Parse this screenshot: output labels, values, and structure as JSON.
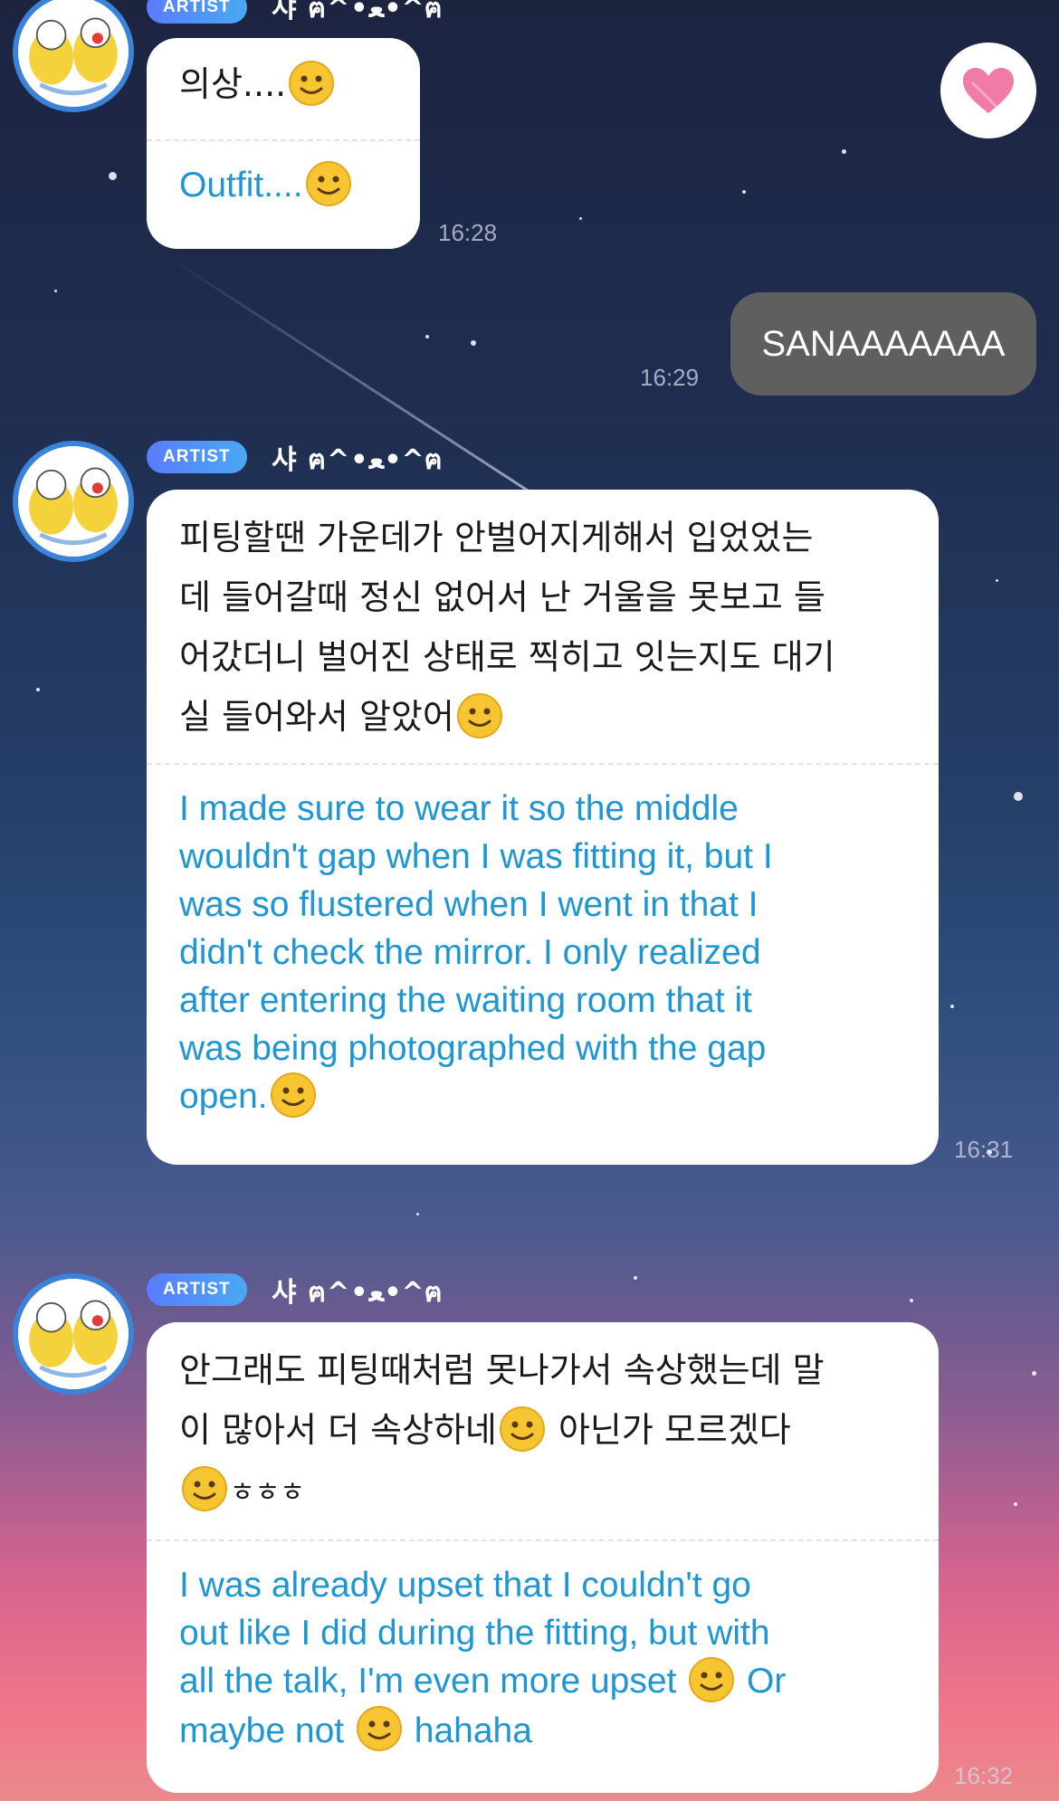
{
  "sender": {
    "badge": "ARTIST",
    "name": "샤 ฅ^•ﻌ•^ฅ"
  },
  "messages": [
    {
      "korean": "의상....",
      "english": "Outfit....",
      "time": "16:28"
    },
    {
      "korean": "피팅할땐 가운데가 안벌어지게해서 입었었는\n데 들어갈때 정신 없어서 난 거울을 못보고 들\n어갔더니 벌어진 상태로 찍히고 잇는지도 대기\n실 들어와서 알았어",
      "english": "I made sure to wear it so the middle\nwouldn't gap when I was fitting it, but I\nwas so flustered when I went in that I\ndidn't check the mirror. I only realized\nafter entering the waiting room that it\nwas being photographed with the gap\nopen.",
      "time": "16:31"
    },
    {
      "korean_line1": "안그래도 피팅때처럼 못나가서 속상했는데 말",
      "korean_line2a": "이 많아서 더 속상하네",
      "korean_line2b": " 아닌가 모르겠다",
      "korean_line3": "ㅎㅎㅎ",
      "english_line1": "I was already upset that I couldn't go",
      "english_line2": "out like I did during the fitting, but with",
      "english_line3a": "all the talk, I'm even more upset",
      "english_line3b": " Or",
      "english_line4a": "maybe not",
      "english_line4b": " hahaha",
      "time": "16:32"
    }
  ],
  "my_message": {
    "text": "SANAAAAAAA",
    "time": "16:29"
  },
  "colors": {
    "english_text": "#1e96d4",
    "badge": "#5a7cff",
    "my_bubble": "#5f5f5f",
    "heart": "#f07aa8"
  },
  "icons": {
    "emoji": "slightly-smiling-face",
    "reaction": "heart-icon"
  }
}
